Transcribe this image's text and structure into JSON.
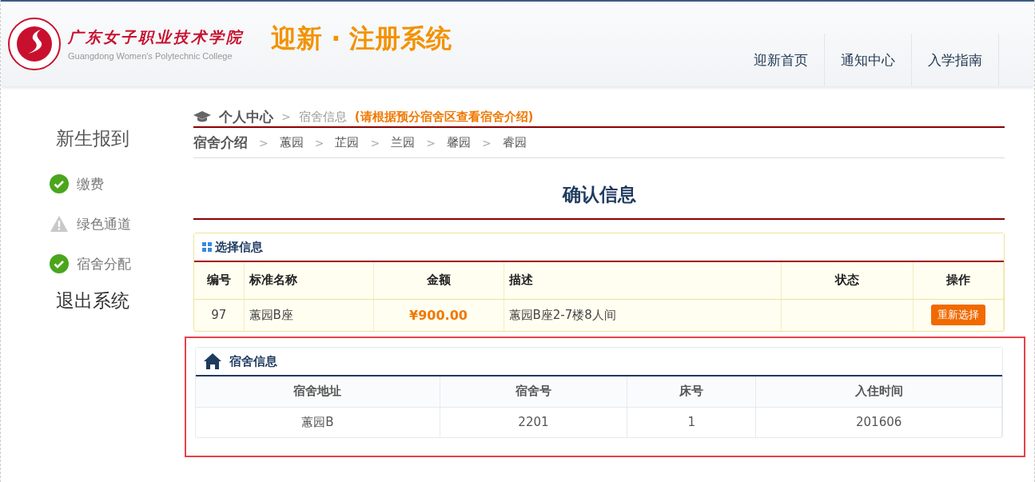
{
  "header": {
    "school_name": "广东女子职业技术学院",
    "school_name_en": "Guangdong Women's Polytechnic College",
    "system_title": "迎新 · 注册系统",
    "nav": [
      {
        "label": "迎新首页"
      },
      {
        "label": "通知中心"
      },
      {
        "label": "入学指南"
      }
    ]
  },
  "sidebar": {
    "title": "新生报到",
    "items": [
      {
        "label": "缴费",
        "kind": "done"
      },
      {
        "label": "绿色通道",
        "kind": "warning"
      },
      {
        "label": "宿舍分配",
        "kind": "done"
      }
    ],
    "logout": "退出系统"
  },
  "breadcrumb": {
    "home": "个人中心",
    "separator": ">",
    "current": "宿舍信息",
    "hint": "(请根据预分宿舍区查看宿舍介绍)"
  },
  "dorm_links": {
    "title": "宿舍介绍",
    "separator": ">",
    "items": [
      "蕙园",
      "芷园",
      "兰园",
      "馨园",
      "睿园"
    ]
  },
  "page_title": "确认信息",
  "selection": {
    "title": "选择信息",
    "columns": [
      "编号",
      "标准名称",
      "金额",
      "描述",
      "状态",
      "操作"
    ],
    "rows": [
      {
        "id": "97",
        "name": "蕙园B座",
        "amount": "¥900.00",
        "description": "蕙园B座2-7楼8人间",
        "status": "",
        "action": "重新选择"
      }
    ]
  },
  "dorm_info": {
    "title": "宿舍信息",
    "highlighted": true,
    "columns": [
      "宿舍地址",
      "宿舍号",
      "床号",
      "入住时间"
    ],
    "rows": [
      [
        "蕙园B",
        "2201",
        "1",
        "201606"
      ]
    ]
  }
}
